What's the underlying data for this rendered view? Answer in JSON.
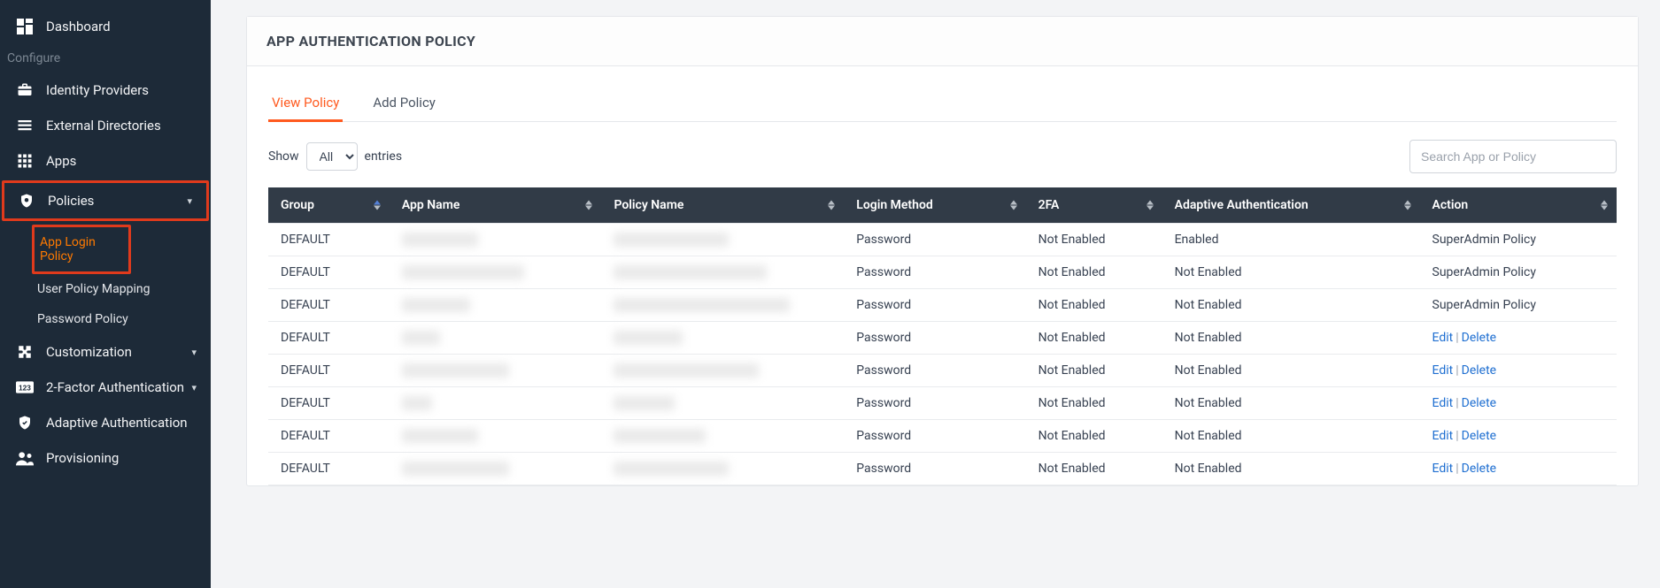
{
  "sidebar": {
    "items": [
      {
        "key": "dashboard",
        "label": "Dashboard"
      }
    ],
    "section_configure": "Configure",
    "configure": [
      {
        "key": "idp",
        "label": "Identity Providers"
      },
      {
        "key": "ext-dir",
        "label": "External Directories"
      },
      {
        "key": "apps",
        "label": "Apps"
      },
      {
        "key": "policies",
        "label": "Policies",
        "children": [
          {
            "key": "app-login-policy",
            "label": "App Login Policy",
            "active": true
          },
          {
            "key": "user-policy-mapping",
            "label": "User Policy Mapping"
          },
          {
            "key": "password-policy",
            "label": "Password Policy"
          }
        ]
      },
      {
        "key": "customization",
        "label": "Customization"
      },
      {
        "key": "2fa",
        "label": "2-Factor Authentication"
      },
      {
        "key": "adaptive-auth",
        "label": "Adaptive Authentication"
      },
      {
        "key": "provisioning",
        "label": "Provisioning"
      }
    ]
  },
  "page_title": "APP AUTHENTICATION POLICY",
  "tabs": [
    {
      "key": "view",
      "label": "View Policy",
      "active": true
    },
    {
      "key": "add",
      "label": "Add Policy"
    }
  ],
  "toolbar": {
    "show_label": "Show",
    "entries_label": "entries",
    "select_value": "All",
    "search_placeholder": "Search App or Policy"
  },
  "table": {
    "columns": [
      {
        "key": "group",
        "label": "Group",
        "sorted": "asc",
        "width": "8%"
      },
      {
        "key": "app_name",
        "label": "App Name",
        "width": "14%"
      },
      {
        "key": "policy_name",
        "label": "Policy Name",
        "width": "16%"
      },
      {
        "key": "login_method",
        "label": "Login Method",
        "width": "12%"
      },
      {
        "key": "twofa",
        "label": "2FA",
        "width": "9%"
      },
      {
        "key": "adaptive",
        "label": "Adaptive Authentication",
        "width": "17%"
      },
      {
        "key": "action",
        "label": "Action",
        "width": "13%"
      }
    ],
    "status_labels": {
      "enabled": "Enabled",
      "not_enabled": "Not Enabled"
    },
    "action_labels": {
      "edit": "Edit",
      "delete": "Delete",
      "super": "SuperAdmin Policy"
    },
    "rows": [
      {
        "group": "DEFAULT",
        "app_name": "##########",
        "policy_name": "###############",
        "login_method": "Password",
        "twofa": "not_enabled",
        "adaptive": "enabled",
        "action_type": "super"
      },
      {
        "group": "DEFAULT",
        "app_name": "################",
        "policy_name": "####################",
        "login_method": "Password",
        "twofa": "not_enabled",
        "adaptive": "not_enabled",
        "action_type": "super"
      },
      {
        "group": "DEFAULT",
        "app_name": "#########",
        "policy_name": "#######################",
        "login_method": "Password",
        "twofa": "not_enabled",
        "adaptive": "not_enabled",
        "action_type": "super"
      },
      {
        "group": "DEFAULT",
        "app_name": "#####",
        "policy_name": "#########",
        "login_method": "Password",
        "twofa": "not_enabled",
        "adaptive": "not_enabled",
        "action_type": "editdelete"
      },
      {
        "group": "DEFAULT",
        "app_name": "##############",
        "policy_name": "###################",
        "login_method": "Password",
        "twofa": "not_enabled",
        "adaptive": "not_enabled",
        "action_type": "editdelete"
      },
      {
        "group": "DEFAULT",
        "app_name": "####",
        "policy_name": "########",
        "login_method": "Password",
        "twofa": "not_enabled",
        "adaptive": "not_enabled",
        "action_type": "editdelete"
      },
      {
        "group": "DEFAULT",
        "app_name": "##########",
        "policy_name": "############",
        "login_method": "Password",
        "twofa": "not_enabled",
        "adaptive": "not_enabled",
        "action_type": "editdelete"
      },
      {
        "group": "DEFAULT",
        "app_name": "##############",
        "policy_name": "###############",
        "login_method": "Password",
        "twofa": "not_enabled",
        "adaptive": "not_enabled",
        "action_type": "editdelete"
      }
    ]
  }
}
